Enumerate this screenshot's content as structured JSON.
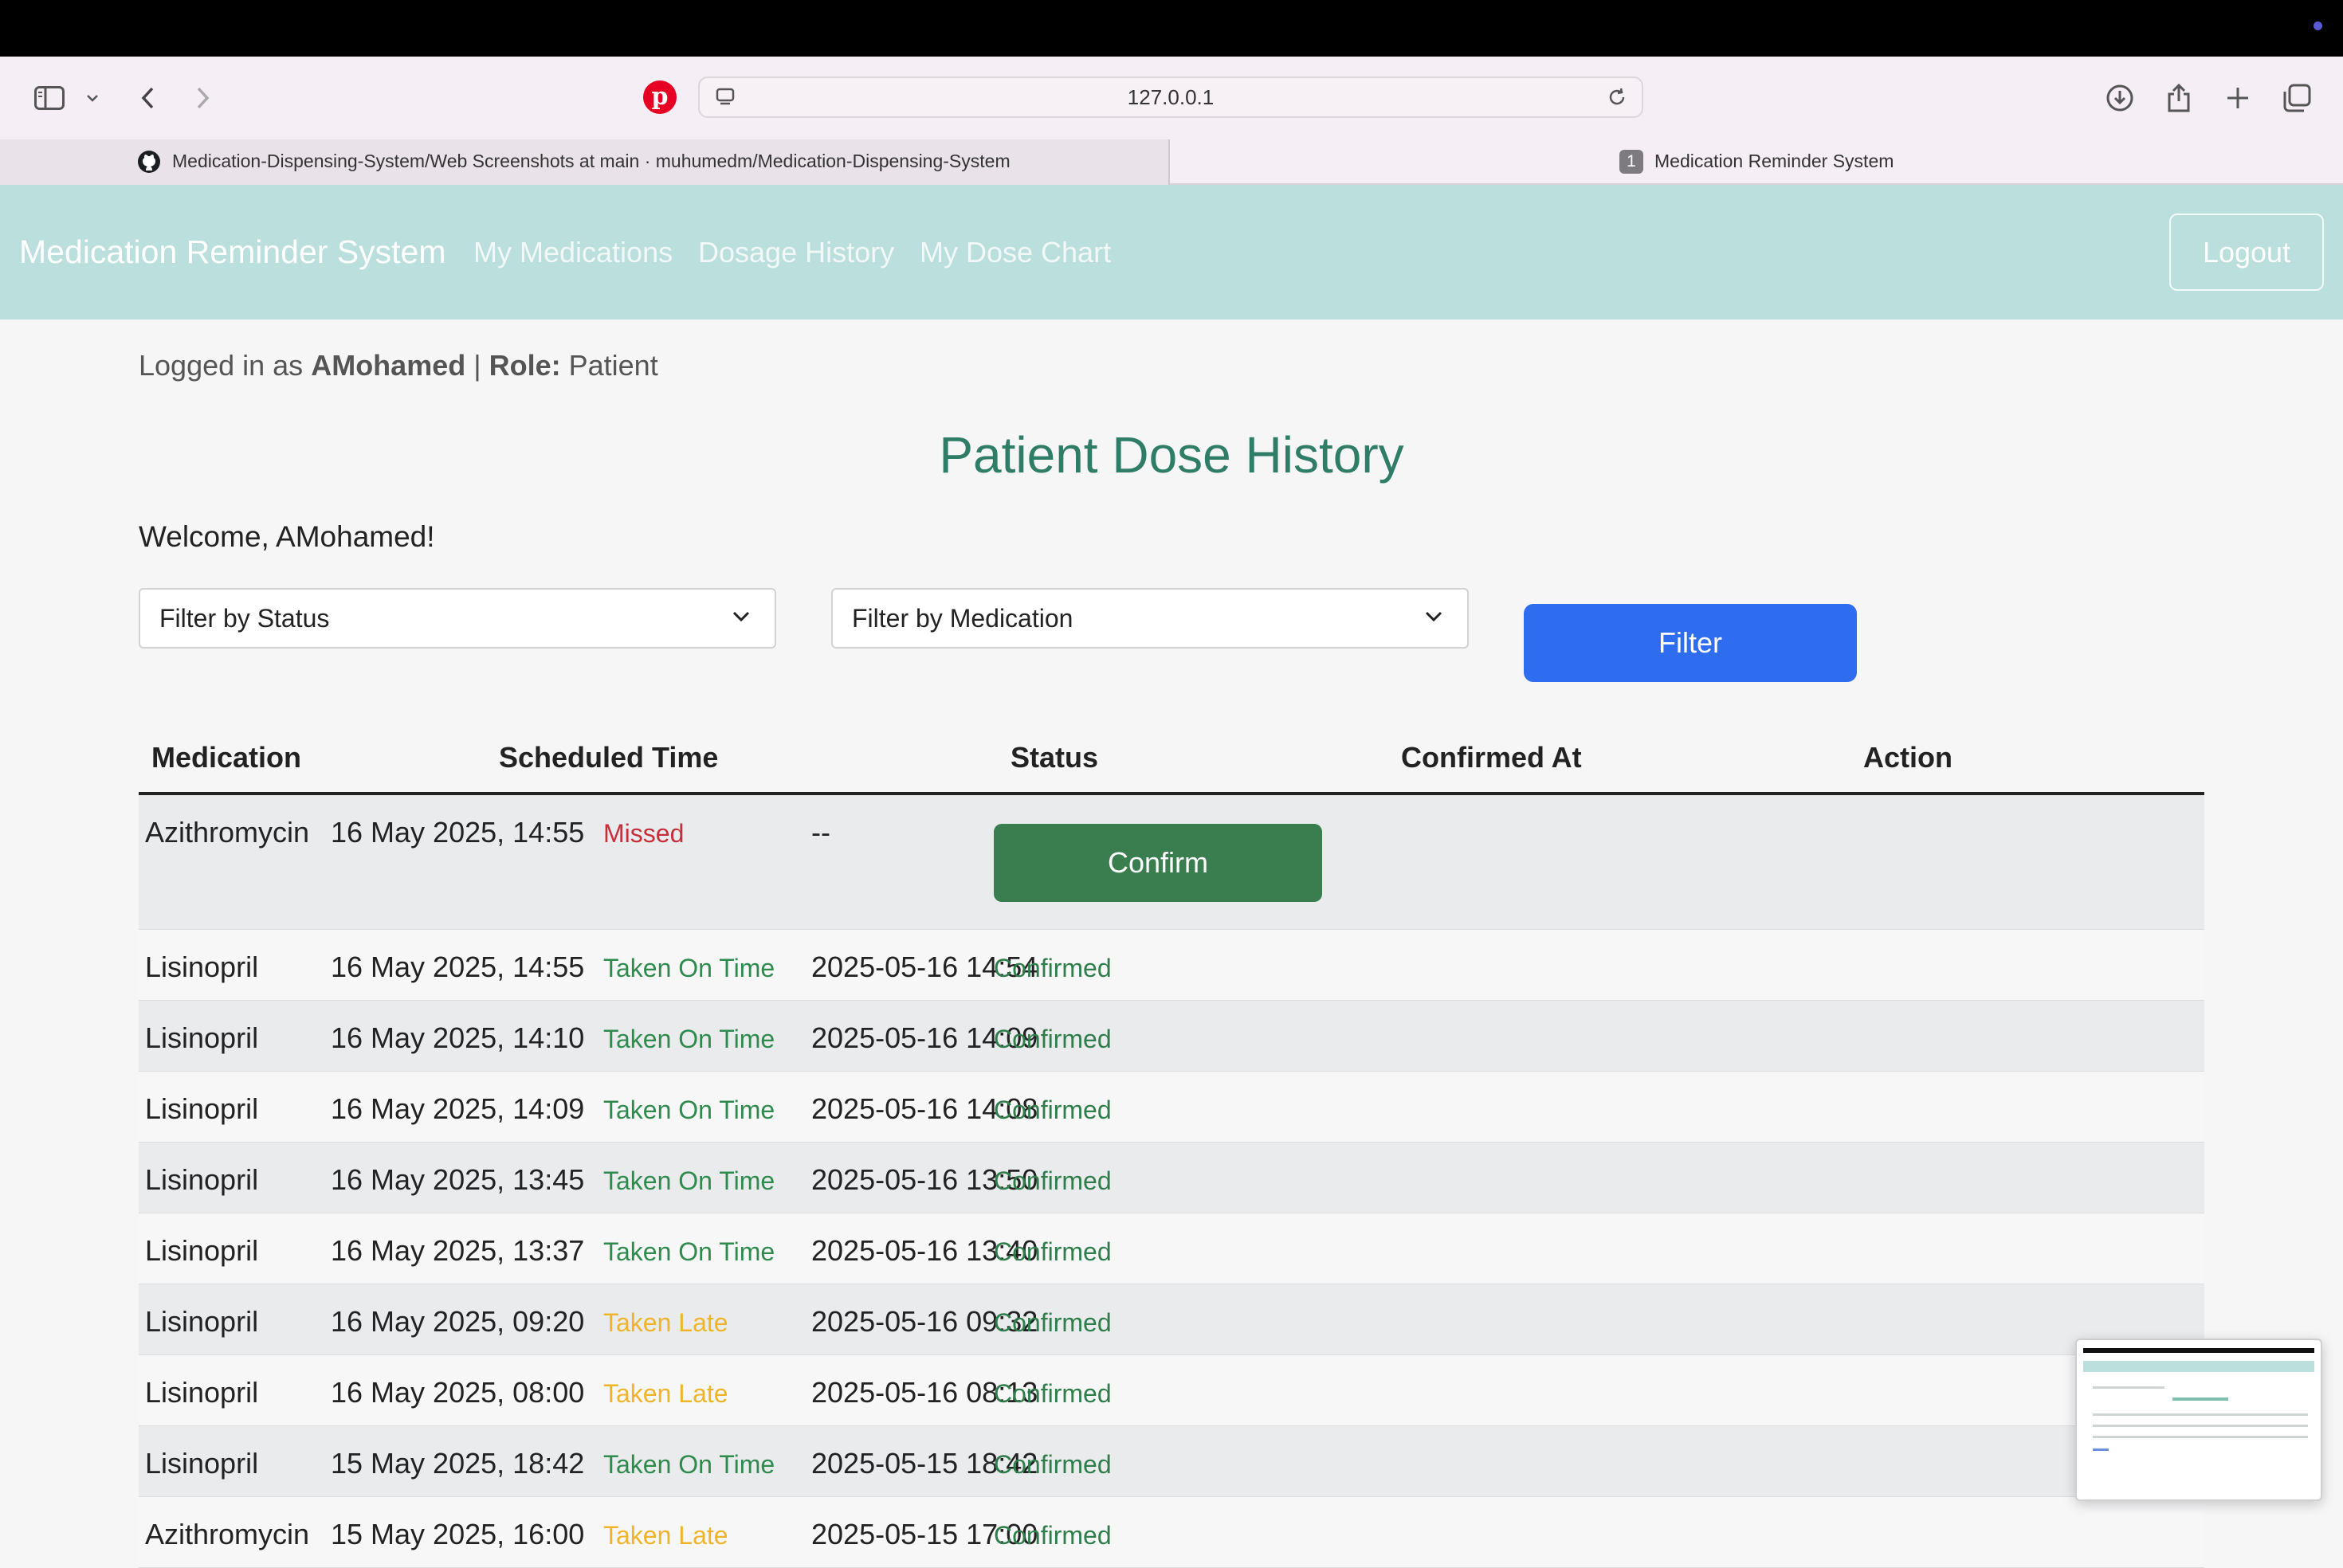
{
  "browser": {
    "url": "127.0.0.1",
    "tabs": [
      {
        "label": "Medication-Dispensing-System/Web Screenshots at main · muhumedm/Medication-Dispensing-System",
        "active": false
      },
      {
        "label": "Medication Reminder System",
        "active": true,
        "badge": "1"
      }
    ]
  },
  "navbar": {
    "brand": "Medication Reminder System",
    "links": [
      "My Medications",
      "Dosage History",
      "My Dose Chart"
    ],
    "logout": "Logout"
  },
  "session": {
    "prefix": "Logged in as",
    "username": "AMohamed",
    "separator": "|",
    "role_label": "Role:",
    "role": "Patient"
  },
  "page": {
    "title": "Patient Dose History",
    "welcome": "Welcome, AMohamed!"
  },
  "filters": {
    "status_placeholder": "Filter by Status",
    "medication_placeholder": "Filter by Medication",
    "button": "Filter"
  },
  "table": {
    "headers": [
      "Medication",
      "Scheduled Time",
      "Status",
      "Confirmed At",
      "Action"
    ],
    "rows": [
      {
        "medication": "Azithromycin",
        "scheduled": "16 May 2025, 14:55",
        "status": "Missed",
        "confirmed_at": "--",
        "action": "Confirm"
      },
      {
        "medication": "Lisinopril",
        "scheduled": "16 May 2025, 14:55",
        "status": "Taken On Time",
        "confirmed_at": "2025-05-16 14:54",
        "action": "Confirmed"
      },
      {
        "medication": "Lisinopril",
        "scheduled": "16 May 2025, 14:10",
        "status": "Taken On Time",
        "confirmed_at": "2025-05-16 14:09",
        "action": "Confirmed"
      },
      {
        "medication": "Lisinopril",
        "scheduled": "16 May 2025, 14:09",
        "status": "Taken On Time",
        "confirmed_at": "2025-05-16 14:08",
        "action": "Confirmed"
      },
      {
        "medication": "Lisinopril",
        "scheduled": "16 May 2025, 13:45",
        "status": "Taken On Time",
        "confirmed_at": "2025-05-16 13:50",
        "action": "Confirmed"
      },
      {
        "medication": "Lisinopril",
        "scheduled": "16 May 2025, 13:37",
        "status": "Taken On Time",
        "confirmed_at": "2025-05-16 13:40",
        "action": "Confirmed"
      },
      {
        "medication": "Lisinopril",
        "scheduled": "16 May 2025, 09:20",
        "status": "Taken Late",
        "confirmed_at": "2025-05-16 09:32",
        "action": "Confirmed"
      },
      {
        "medication": "Lisinopril",
        "scheduled": "16 May 2025, 08:00",
        "status": "Taken Late",
        "confirmed_at": "2025-05-16 08:13",
        "action": "Confirmed"
      },
      {
        "medication": "Lisinopril",
        "scheduled": "15 May 2025, 18:42",
        "status": "Taken On Time",
        "confirmed_at": "2025-05-15 18:42",
        "action": "Confirmed"
      },
      {
        "medication": "Azithromycin",
        "scheduled": "15 May 2025, 16:00",
        "status": "Taken Late",
        "confirmed_at": "2025-05-15 17:00",
        "action": "Confirmed"
      }
    ]
  },
  "colors": {
    "navbar_bg": "#badfdc",
    "title": "#2f7d67",
    "filter_button": "#2f6df0",
    "confirm_button": "#3a7d4f",
    "missed": "#c62f3a",
    "on_time": "#2f8a4d",
    "late": "#f0b429"
  },
  "icons": [
    "sidebar-icon",
    "chevron-down-icon",
    "back-icon",
    "forward-icon",
    "pinterest-icon",
    "page-icon",
    "reload-icon",
    "download-icon",
    "share-icon",
    "new-tab-icon",
    "tab-overview-icon",
    "github-icon"
  ]
}
